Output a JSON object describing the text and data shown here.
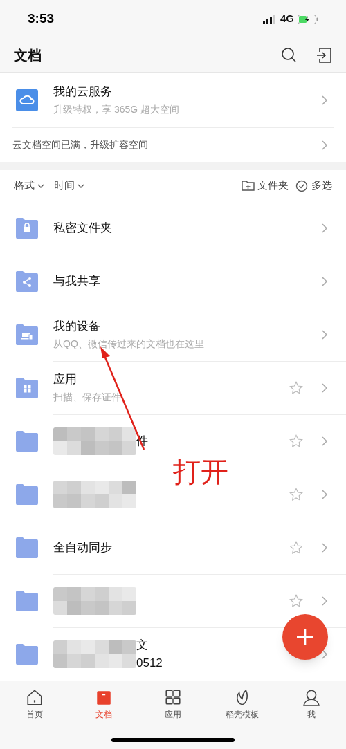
{
  "status_bar": {
    "time": "3:53",
    "network": "4G"
  },
  "header": {
    "title": "文档"
  },
  "cloud_service": {
    "title": "我的云服务",
    "subtitle": "升级特权，享 365G 超大空间"
  },
  "banner": {
    "text": "云文档空间已满，升级扩容空间"
  },
  "filters": [
    {
      "label": "格式"
    },
    {
      "label": "时间"
    }
  ],
  "actions": [
    {
      "kind": "new-folder",
      "label": "文件夹"
    },
    {
      "kind": "select",
      "label": "多选"
    }
  ],
  "rows": [
    {
      "kind": "lock",
      "title": "私密文件夹"
    },
    {
      "kind": "share",
      "title": "与我共享"
    },
    {
      "kind": "device",
      "title": "我的设备",
      "subtitle": "从QQ、微信传过来的文档也在这里"
    },
    {
      "kind": "apps",
      "title": "应用",
      "subtitle": "扫描、保存证件",
      "star": true
    },
    {
      "kind": "folder",
      "title": "件",
      "redacted": true,
      "star": true
    },
    {
      "kind": "folder",
      "redacted": true,
      "star": true
    },
    {
      "kind": "folder",
      "title": "全自动同步",
      "star": true
    },
    {
      "kind": "folder",
      "redacted": true,
      "star": true
    },
    {
      "kind": "folder",
      "title": "文",
      "subtitle": "0512",
      "redacted": true
    }
  ],
  "annotation": {
    "text": "打开"
  },
  "tabs": [
    {
      "kind": "home",
      "label": "首页",
      "selected": false
    },
    {
      "kind": "docs",
      "label": "文档",
      "selected": true
    },
    {
      "kind": "apps",
      "label": "应用",
      "selected": false
    },
    {
      "kind": "leaf",
      "label": "稻壳模板",
      "selected": false
    },
    {
      "kind": "user",
      "label": "我",
      "selected": false
    }
  ]
}
